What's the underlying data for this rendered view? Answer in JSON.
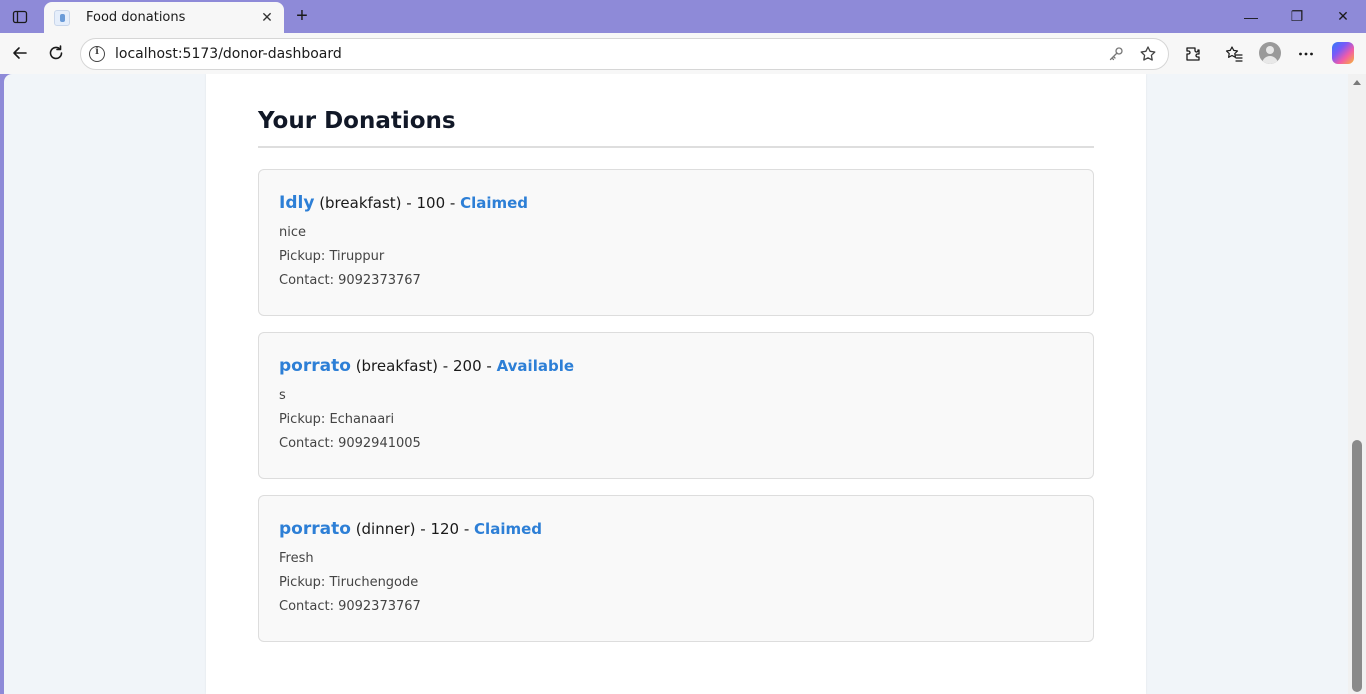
{
  "browser": {
    "tab_title": "Food donations",
    "tab_close": "✕",
    "new_tab": "+",
    "url": "localhost:5173/donor-dashboard",
    "window_controls": {
      "minimize": "—",
      "restore": "❐",
      "close": "✕"
    }
  },
  "page": {
    "section_title": "Your Donations",
    "donations": [
      {
        "name": "Idly",
        "meal": "(breakfast)",
        "sep1": " - ",
        "quantity": "100",
        "sep2": " - ",
        "status": "Claimed",
        "description": "nice",
        "pickup": "Pickup: Tiruppur",
        "contact": "Contact: 9092373767"
      },
      {
        "name": "porrato",
        "meal": "(breakfast)",
        "sep1": " - ",
        "quantity": "200",
        "sep2": " - ",
        "status": "Available",
        "description": "s",
        "pickup": "Pickup: Echanaari",
        "contact": "Contact: 9092941005"
      },
      {
        "name": "porrato",
        "meal": "(dinner)",
        "sep1": " - ",
        "quantity": "120",
        "sep2": " - ",
        "status": "Claimed",
        "description": "Fresh",
        "pickup": "Pickup: Tiruchengode",
        "contact": "Contact: 9092373767"
      }
    ]
  },
  "colors": {
    "titlebar": "#8e8ad8",
    "accent": "#2d7fd6",
    "heading": "#111827"
  }
}
